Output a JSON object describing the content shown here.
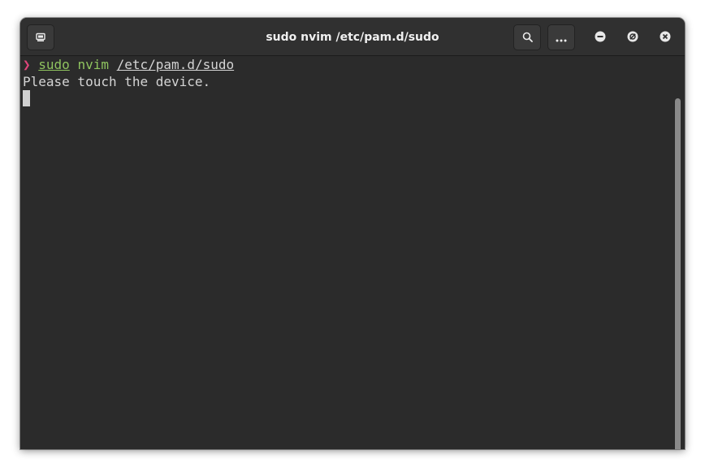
{
  "window": {
    "title": "sudo nvim /etc/pam.d/sudo"
  },
  "headerbar": {
    "new_tab_icon": "new-terminal-icon",
    "search_icon": "search-icon",
    "menu_icon": "ellipsis-icon",
    "controls": [
      "minimize-icon",
      "maximize-icon",
      "close-icon"
    ]
  },
  "terminal": {
    "prompt_symbol": "❯",
    "command": {
      "sudo": "sudo",
      "nvim": "nvim",
      "path": "/etc/pam.d/sudo"
    },
    "output_line": "Please touch the device."
  },
  "colors": {
    "prompt": "#e0457b",
    "command": "#8fc35f",
    "text": "#d4d4d4",
    "background": "#2b2b2b",
    "headerbar": "#303030"
  }
}
